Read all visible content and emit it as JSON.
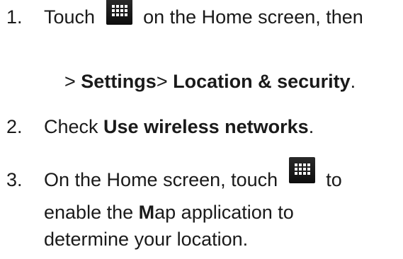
{
  "steps": [
    {
      "number": "1.",
      "line1_before_icon": "Touch",
      "icon": "apps-grid-icon",
      "line1_after_icon": "on the Home screen, then",
      "line2_prefix": ">",
      "line2_settings": "Settings",
      "line2_separator": ">",
      "line2_location": "Location & security",
      "line2_end": "."
    },
    {
      "number": "2.",
      "text_before": "Check",
      "bold": "Use wireless networks",
      "text_after": "."
    },
    {
      "number": "3.",
      "line1_before_icon": "On the Home screen, touch",
      "icon": "apps-grid-icon",
      "line1_after_icon": "to",
      "line2_before_bold": "enable the",
      "line2_bold": "M",
      "line2_after_bold": "ap application to",
      "line3": "determine your location."
    }
  ]
}
